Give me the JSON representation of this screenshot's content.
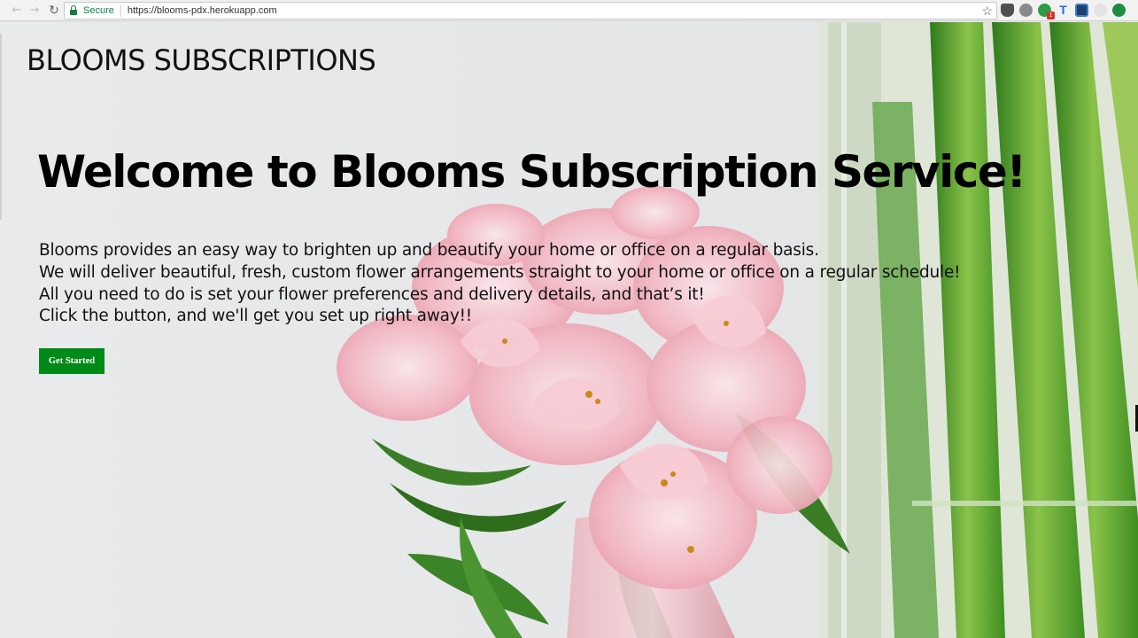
{
  "browser": {
    "secure_label": "Secure",
    "url": "https://blooms-pdx.herokuapp.com",
    "extension_badge": "1",
    "icons": [
      "back-icon",
      "forward-icon",
      "reload-icon",
      "lock-icon",
      "star-icon",
      "pocket-icon",
      "ghostery-icon",
      "grammarly-icon",
      "font-icon",
      "extension-square-icon",
      "cloud-icon",
      "download-icon"
    ]
  },
  "site": {
    "brand": "BLOOMS SUBSCRIPTIONS",
    "headline": "Welcome to Blooms Subscription Service!",
    "intro_lines": [
      "Blooms provides an easy way to brighten up and beautify your home or office on a regular basis.",
      "We will deliver beautiful, fresh, custom flower arrangements straight to your home or office on a regular schedule!",
      "All you need to do is set your flower preferences and delivery details, and that’s it!",
      "Click the button, and we'll get you set up right away!!"
    ],
    "cta_label": "Get Started"
  },
  "colors": {
    "background": "#e7e8ea",
    "cta_bg": "#008a17",
    "secure_green": "#0b8043",
    "petal_pink": "#f2b8c2",
    "leaf_green": "#3f8f2a"
  }
}
